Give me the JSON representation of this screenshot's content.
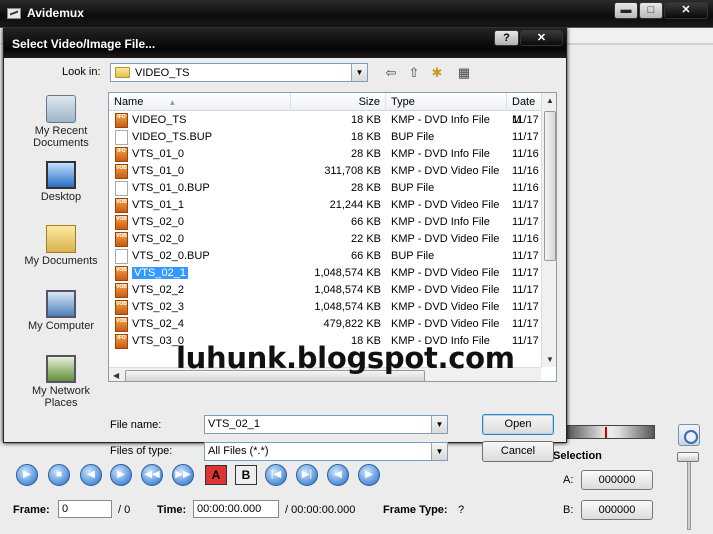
{
  "app": {
    "title": "Avidemux"
  },
  "window_controls": {
    "minimize": "▬",
    "maximize": "□",
    "close": "✕"
  },
  "dialog": {
    "title": "Select Video/Image File...",
    "help": "?",
    "close": "✕",
    "look_in_label": "Look in:",
    "look_in_value": "VIDEO_TS",
    "places": [
      {
        "label1": "My Recent",
        "label2": "Documents",
        "icon": "recent-documents-icon"
      },
      {
        "label1": "Desktop",
        "label2": "",
        "icon": "desktop-icon"
      },
      {
        "label1": "My Documents",
        "label2": "",
        "icon": "my-documents-icon"
      },
      {
        "label1": "My Computer",
        "label2": "",
        "icon": "my-computer-icon"
      },
      {
        "label1": "My Network",
        "label2": "Places",
        "icon": "network-places-icon"
      }
    ],
    "columns": {
      "name": "Name",
      "size": "Size",
      "type": "Type",
      "date": "Date M"
    },
    "files": [
      {
        "name": "VIDEO_TS",
        "icon": "IFO",
        "size": "18 KB",
        "type": "KMP - DVD Info File",
        "date": "11/17"
      },
      {
        "name": "VIDEO_TS.BUP",
        "icon": "BUP",
        "size": "18 KB",
        "type": "BUP File",
        "date": "11/17"
      },
      {
        "name": "VTS_01_0",
        "icon": "IFO",
        "size": "28 KB",
        "type": "KMP - DVD Info File",
        "date": "11/16"
      },
      {
        "name": "VTS_01_0",
        "icon": "VOB",
        "size": "311,708 KB",
        "type": "KMP - DVD Video File",
        "date": "11/16"
      },
      {
        "name": "VTS_01_0.BUP",
        "icon": "BUP",
        "size": "28 KB",
        "type": "BUP File",
        "date": "11/16"
      },
      {
        "name": "VTS_01_1",
        "icon": "VOB",
        "size": "21,244 KB",
        "type": "KMP - DVD Video File",
        "date": "11/17"
      },
      {
        "name": "VTS_02_0",
        "icon": "VOB",
        "size": "66 KB",
        "type": "KMP - DVD Info File",
        "date": "11/17"
      },
      {
        "name": "VTS_02_0",
        "icon": "VOB",
        "size": "22 KB",
        "type": "KMP - DVD Video File",
        "date": "11/16"
      },
      {
        "name": "VTS_02_0.BUP",
        "icon": "BUP",
        "size": "66 KB",
        "type": "BUP File",
        "date": "11/17"
      },
      {
        "name": "VTS_02_1",
        "icon": "VOB",
        "size": "1,048,574 KB",
        "type": "KMP - DVD Video File",
        "date": "11/17",
        "selected": true
      },
      {
        "name": "VTS_02_2",
        "icon": "VOB",
        "size": "1,048,574 KB",
        "type": "KMP - DVD Video File",
        "date": "11/17"
      },
      {
        "name": "VTS_02_3",
        "icon": "VOB",
        "size": "1,048,574 KB",
        "type": "KMP - DVD Video File",
        "date": "11/17"
      },
      {
        "name": "VTS_02_4",
        "icon": "VOB",
        "size": "479,822 KB",
        "type": "KMP - DVD Video File",
        "date": "11/17"
      },
      {
        "name": "VTS_03_0",
        "icon": "IFO",
        "size": "18 KB",
        "type": "KMP - DVD Info File",
        "date": "11/17"
      }
    ],
    "file_name_label": "File name:",
    "file_name_value": "VTS_02_1",
    "files_of_type_label": "Files of type:",
    "files_of_type_value": "All Files (*.*)",
    "open_button": "Open",
    "cancel_button": "Cancel"
  },
  "watermark": "luhunk.blogspot.com",
  "controls": {
    "frame_label": "Frame:",
    "frame_value": "0",
    "frame_total": "/ 0",
    "time_label": "Time:",
    "time_value": "00:00:00.000",
    "time_total": "/ 00:00:00.000",
    "frame_type_label": "Frame Type:",
    "frame_type_value": "?",
    "selection_label": "Selection",
    "a_label": "A:",
    "a_value": "000000",
    "b_label": "B:",
    "b_value": "000000",
    "marker_a": "A",
    "marker_b": "B"
  }
}
